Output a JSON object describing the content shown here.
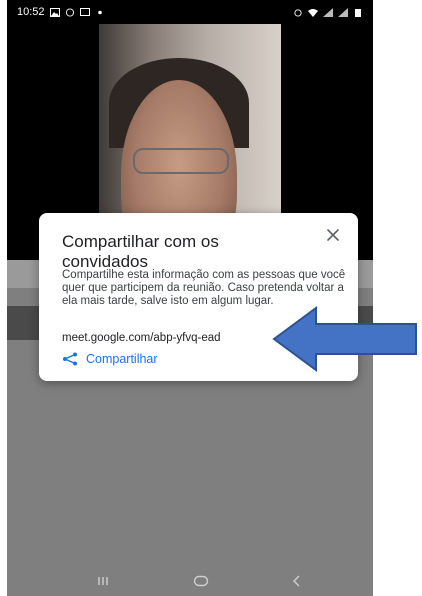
{
  "status_bar": {
    "time": "10:52"
  },
  "dialog": {
    "title": "Compartilhar com os convidados",
    "body": "Compartilhe esta informação com as pessoas que você quer que participem da reunião. Caso pretenda voltar a ela mais tarde, salve isto em algum lugar.",
    "meeting_link": "meet.google.com/abp-yfvq-ead",
    "share_label": "Compartilhar"
  },
  "colors": {
    "accent": "#1a73e8",
    "annotation_arrow": "#4472c4",
    "dim_background": "#7f7f7f"
  },
  "icons": {
    "close": "close-icon",
    "share": "share-icon",
    "nav_recents": "recents-icon",
    "nav_home": "home-icon",
    "nav_back": "back-icon"
  }
}
